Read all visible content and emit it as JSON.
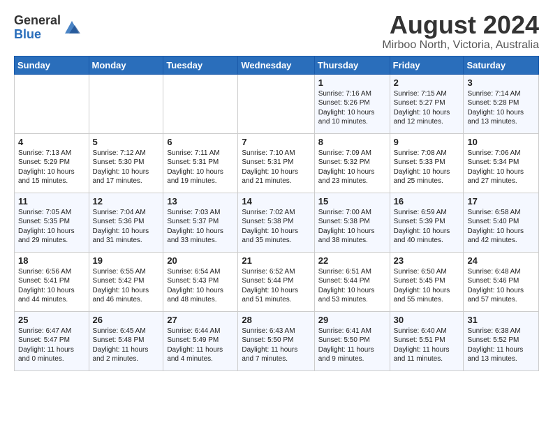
{
  "logo": {
    "general": "General",
    "blue": "Blue"
  },
  "title": "August 2024",
  "subtitle": "Mirboo North, Victoria, Australia",
  "days_of_week": [
    "Sunday",
    "Monday",
    "Tuesday",
    "Wednesday",
    "Thursday",
    "Friday",
    "Saturday"
  ],
  "weeks": [
    [
      {
        "day": "",
        "info": ""
      },
      {
        "day": "",
        "info": ""
      },
      {
        "day": "",
        "info": ""
      },
      {
        "day": "",
        "info": ""
      },
      {
        "day": "1",
        "info": "Sunrise: 7:16 AM\nSunset: 5:26 PM\nDaylight: 10 hours\nand 10 minutes."
      },
      {
        "day": "2",
        "info": "Sunrise: 7:15 AM\nSunset: 5:27 PM\nDaylight: 10 hours\nand 12 minutes."
      },
      {
        "day": "3",
        "info": "Sunrise: 7:14 AM\nSunset: 5:28 PM\nDaylight: 10 hours\nand 13 minutes."
      }
    ],
    [
      {
        "day": "4",
        "info": "Sunrise: 7:13 AM\nSunset: 5:29 PM\nDaylight: 10 hours\nand 15 minutes."
      },
      {
        "day": "5",
        "info": "Sunrise: 7:12 AM\nSunset: 5:30 PM\nDaylight: 10 hours\nand 17 minutes."
      },
      {
        "day": "6",
        "info": "Sunrise: 7:11 AM\nSunset: 5:31 PM\nDaylight: 10 hours\nand 19 minutes."
      },
      {
        "day": "7",
        "info": "Sunrise: 7:10 AM\nSunset: 5:31 PM\nDaylight: 10 hours\nand 21 minutes."
      },
      {
        "day": "8",
        "info": "Sunrise: 7:09 AM\nSunset: 5:32 PM\nDaylight: 10 hours\nand 23 minutes."
      },
      {
        "day": "9",
        "info": "Sunrise: 7:08 AM\nSunset: 5:33 PM\nDaylight: 10 hours\nand 25 minutes."
      },
      {
        "day": "10",
        "info": "Sunrise: 7:06 AM\nSunset: 5:34 PM\nDaylight: 10 hours\nand 27 minutes."
      }
    ],
    [
      {
        "day": "11",
        "info": "Sunrise: 7:05 AM\nSunset: 5:35 PM\nDaylight: 10 hours\nand 29 minutes."
      },
      {
        "day": "12",
        "info": "Sunrise: 7:04 AM\nSunset: 5:36 PM\nDaylight: 10 hours\nand 31 minutes."
      },
      {
        "day": "13",
        "info": "Sunrise: 7:03 AM\nSunset: 5:37 PM\nDaylight: 10 hours\nand 33 minutes."
      },
      {
        "day": "14",
        "info": "Sunrise: 7:02 AM\nSunset: 5:38 PM\nDaylight: 10 hours\nand 35 minutes."
      },
      {
        "day": "15",
        "info": "Sunrise: 7:00 AM\nSunset: 5:38 PM\nDaylight: 10 hours\nand 38 minutes."
      },
      {
        "day": "16",
        "info": "Sunrise: 6:59 AM\nSunset: 5:39 PM\nDaylight: 10 hours\nand 40 minutes."
      },
      {
        "day": "17",
        "info": "Sunrise: 6:58 AM\nSunset: 5:40 PM\nDaylight: 10 hours\nand 42 minutes."
      }
    ],
    [
      {
        "day": "18",
        "info": "Sunrise: 6:56 AM\nSunset: 5:41 PM\nDaylight: 10 hours\nand 44 minutes."
      },
      {
        "day": "19",
        "info": "Sunrise: 6:55 AM\nSunset: 5:42 PM\nDaylight: 10 hours\nand 46 minutes."
      },
      {
        "day": "20",
        "info": "Sunrise: 6:54 AM\nSunset: 5:43 PM\nDaylight: 10 hours\nand 48 minutes."
      },
      {
        "day": "21",
        "info": "Sunrise: 6:52 AM\nSunset: 5:44 PM\nDaylight: 10 hours\nand 51 minutes."
      },
      {
        "day": "22",
        "info": "Sunrise: 6:51 AM\nSunset: 5:44 PM\nDaylight: 10 hours\nand 53 minutes."
      },
      {
        "day": "23",
        "info": "Sunrise: 6:50 AM\nSunset: 5:45 PM\nDaylight: 10 hours\nand 55 minutes."
      },
      {
        "day": "24",
        "info": "Sunrise: 6:48 AM\nSunset: 5:46 PM\nDaylight: 10 hours\nand 57 minutes."
      }
    ],
    [
      {
        "day": "25",
        "info": "Sunrise: 6:47 AM\nSunset: 5:47 PM\nDaylight: 11 hours\nand 0 minutes."
      },
      {
        "day": "26",
        "info": "Sunrise: 6:45 AM\nSunset: 5:48 PM\nDaylight: 11 hours\nand 2 minutes."
      },
      {
        "day": "27",
        "info": "Sunrise: 6:44 AM\nSunset: 5:49 PM\nDaylight: 11 hours\nand 4 minutes."
      },
      {
        "day": "28",
        "info": "Sunrise: 6:43 AM\nSunset: 5:50 PM\nDaylight: 11 hours\nand 7 minutes."
      },
      {
        "day": "29",
        "info": "Sunrise: 6:41 AM\nSunset: 5:50 PM\nDaylight: 11 hours\nand 9 minutes."
      },
      {
        "day": "30",
        "info": "Sunrise: 6:40 AM\nSunset: 5:51 PM\nDaylight: 11 hours\nand 11 minutes."
      },
      {
        "day": "31",
        "info": "Sunrise: 6:38 AM\nSunset: 5:52 PM\nDaylight: 11 hours\nand 13 minutes."
      }
    ]
  ]
}
